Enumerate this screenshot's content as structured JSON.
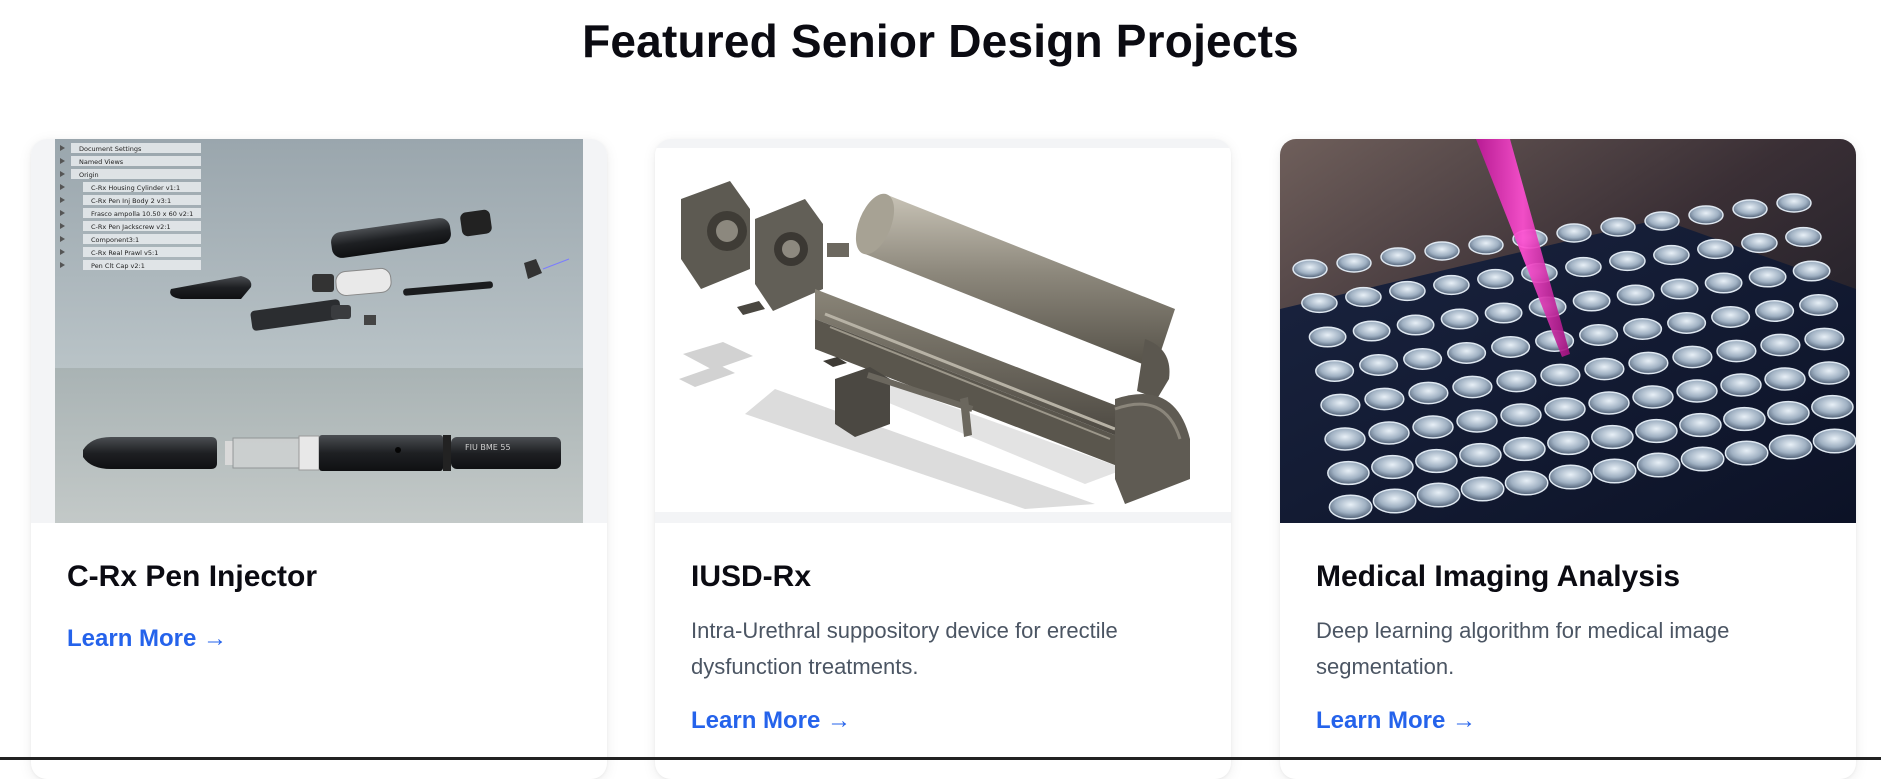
{
  "page": {
    "title": "Featured Senior Design Projects"
  },
  "projects": [
    {
      "title": "C-Rx Pen Injector",
      "description": "",
      "link_label": "Learn More →",
      "image_icon": "cad-render-pen-injector",
      "cad_tree": [
        "Document Settings",
        "Named Views",
        "Origin",
        "C-Rx Housing Cylinder v1:1",
        "C-Rx Pen Inj Body 2 v3:1",
        "Frasco ampolla 10.50 x 60 v2:1",
        "C-Rx Pen Jackscrew v2:1",
        "Component3:1",
        "C-Rx Real Prawl v5:1",
        "Pen Clt Cap v2:1"
      ],
      "pen_label": "FIU BME 55"
    },
    {
      "title": "IUSD-Rx",
      "description": "Intra-Urethral suppository device for erectile dysfunction treatments.",
      "link_label": "Learn More →",
      "image_icon": "cad-exploded-device"
    },
    {
      "title": "Medical Imaging Analysis",
      "description": "Deep learning algorithm for medical image segmentation.",
      "link_label": "Learn More →",
      "image_icon": "lab-pipette-tray-photo"
    }
  ],
  "colors": {
    "link": "#2563eb",
    "title": "#0b0b12",
    "description": "#4b5563"
  }
}
